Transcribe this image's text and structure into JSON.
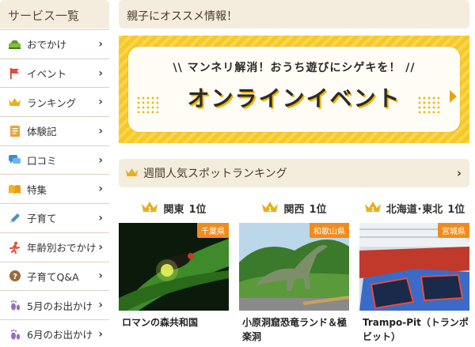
{
  "sidebar": {
    "title": "サービス一覧",
    "items": [
      {
        "label": "おでかけ",
        "icon": "car-icon"
      },
      {
        "label": "イベント",
        "icon": "flag-icon"
      },
      {
        "label": "ランキング",
        "icon": "crown-icon"
      },
      {
        "label": "体験記",
        "icon": "notebook-icon"
      },
      {
        "label": "口コミ",
        "icon": "speech-bubble-icon"
      },
      {
        "label": "特集",
        "icon": "book-icon"
      },
      {
        "label": "子育て",
        "icon": "pencil-icon"
      },
      {
        "label": "年齢別おでかけ",
        "icon": "running-person-icon"
      },
      {
        "label": "子育てQ&A",
        "icon": "question-icon"
      },
      {
        "label": "5月のお出かけ",
        "icon": "footprint-icon"
      },
      {
        "label": "6月のお出かけ",
        "icon": "footprint-icon"
      }
    ]
  },
  "main": {
    "title": "親子にオススメ情報！",
    "banner": {
      "top_text": "\\\\ マンネリ解消！おうち遊びにシゲキを！ //",
      "main_text": "オンラインイベント"
    },
    "ranking": {
      "title": "週間人気スポットランキング",
      "columns": [
        {
          "region": "関東",
          "rank": "1位",
          "pref": "千葉県",
          "name": "ロマンの森共和国"
        },
        {
          "region": "関西",
          "rank": "1位",
          "pref": "和歌山県",
          "name": "小原洞窟恐竜ランド＆極楽洞"
        },
        {
          "region": "北海道･東北",
          "rank": "1位",
          "pref": "宮城県",
          "name": "Trampo-Pit（トランポビット）"
        }
      ]
    }
  },
  "colors": {
    "accent_orange": "#f08c1e",
    "banner_yellow": "#f7c923",
    "header_beige": "#f4ecdd"
  }
}
